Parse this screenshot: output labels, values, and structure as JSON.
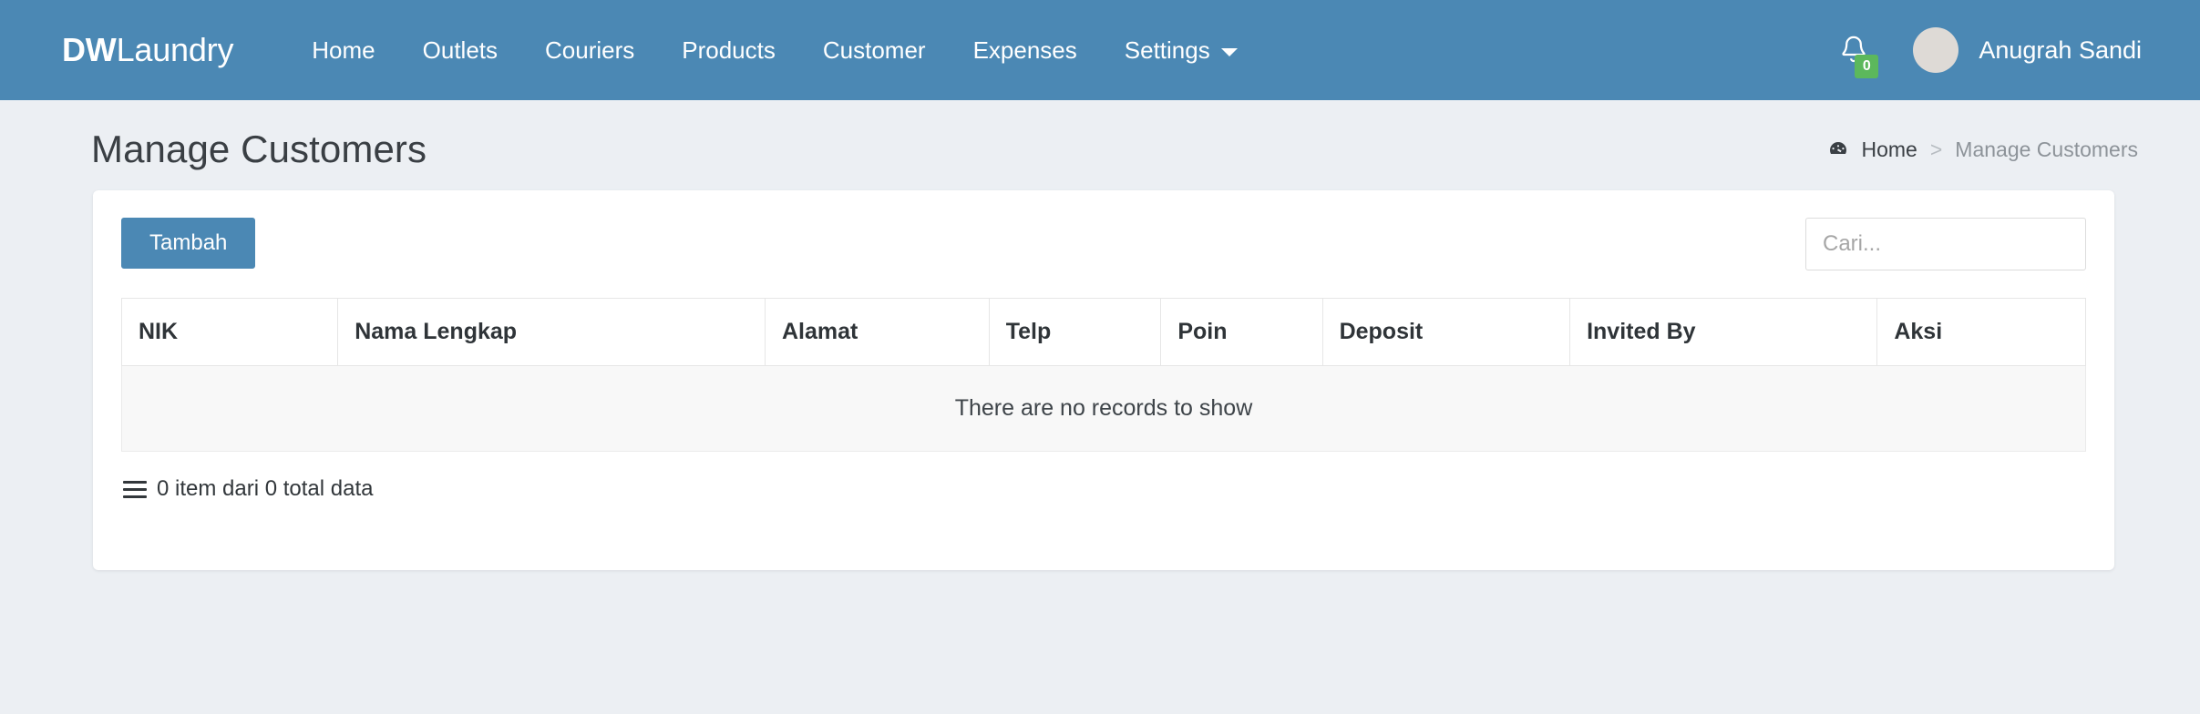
{
  "navbar": {
    "brand_bold": "DW",
    "brand_light": "Laundry",
    "links": [
      {
        "label": "Home"
      },
      {
        "label": "Outlets"
      },
      {
        "label": "Couriers"
      },
      {
        "label": "Products"
      },
      {
        "label": "Customer"
      },
      {
        "label": "Expenses"
      },
      {
        "label": "Settings",
        "has_caret": true
      }
    ],
    "notification_count": "0",
    "notification_badge_color": "#5cb85c",
    "user_name": "Anugrah Sandi",
    "brand_bg": "#4b88b4"
  },
  "page": {
    "title": "Manage Customers",
    "breadcrumb": {
      "home_label": "Home",
      "separator": ">",
      "current_label": "Manage Customers"
    }
  },
  "toolbar": {
    "add_label": "Tambah",
    "search_placeholder": "Cari...",
    "search_value": ""
  },
  "table": {
    "columns": [
      "NIK",
      "Nama Lengkap",
      "Alamat",
      "Telp",
      "Poin",
      "Deposit",
      "Invited By",
      "Aksi"
    ],
    "rows": [],
    "empty_message": "There are no records to show",
    "footer_text": "0 item dari 0 total data"
  }
}
